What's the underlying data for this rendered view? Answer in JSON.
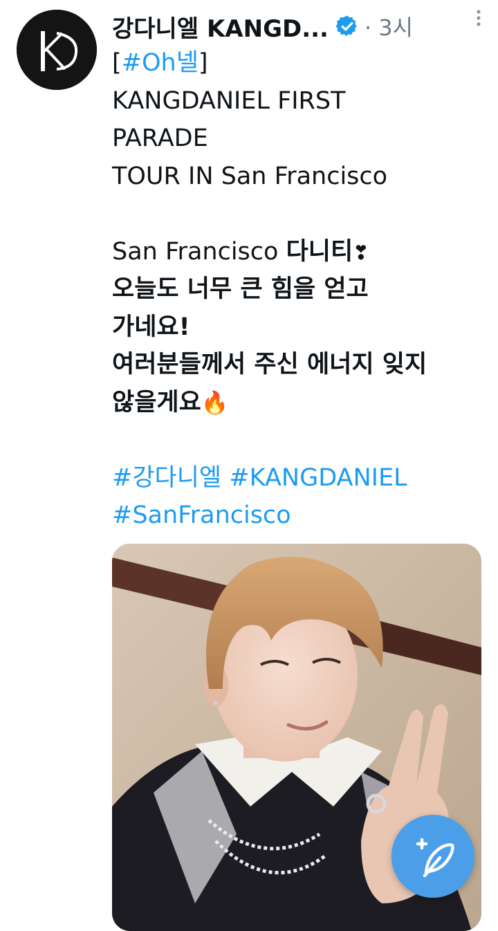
{
  "tweet": {
    "author": {
      "display_name": "강다니엘 KANGD...",
      "verified": true,
      "avatar_icon": "kd-logo-icon"
    },
    "meta": "· 3시",
    "text": {
      "bracket_open": "[",
      "tag": "#Oh넬",
      "bracket_close": "]",
      "line1": "KANGDANIEL FIRST",
      "line2": "PARADE",
      "line3": "TOUR IN San Francisco",
      "line4_en": "San Francisco ",
      "line4_kr": "다니티",
      "line4_emoji": "❣",
      "line5": "오늘도 너무 큰 힘을 얻고",
      "line6": "가네요!",
      "line7": "여러분들께서 주신 에너지 잊지",
      "line8": "않을게요",
      "line8_emoji": "🔥"
    },
    "hashtags": [
      "#강다니엘",
      "#KANGDANIEL",
      "#SanFrancisco"
    ],
    "media_icon": "selfie-photo"
  },
  "colors": {
    "link": "#1d9bf0",
    "fab": "#4b9ee8",
    "verified": "#1d9bf0",
    "meta": "#6b7a86"
  },
  "fab_icon": "compose-feather-plus-icon",
  "more_icon": "more-vertical-icon"
}
